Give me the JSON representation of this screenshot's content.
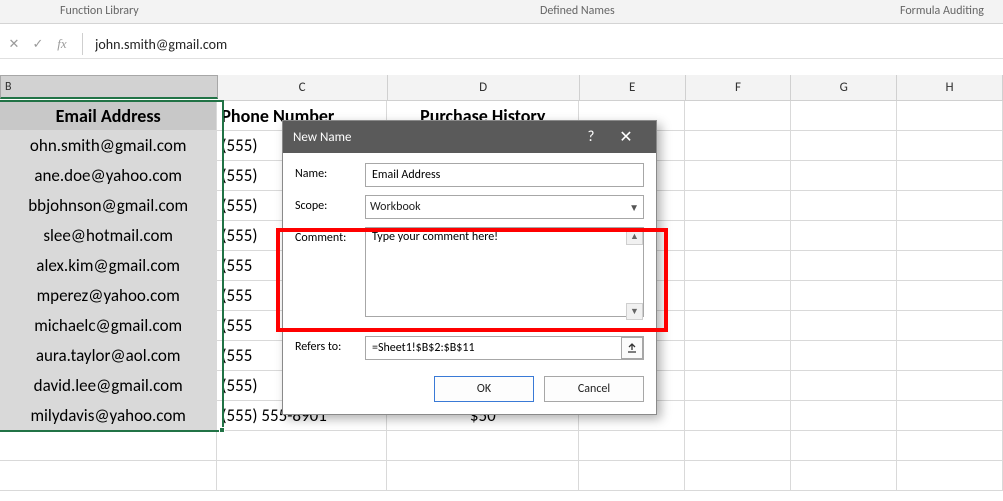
{
  "ribbon": {
    "group1": "Function Library",
    "group2": "Defined Names",
    "group3": "Formula Auditing"
  },
  "formula_bar": {
    "cancel_icon": "✕",
    "accept_icon": "✓",
    "fx_label": "fx",
    "value": "john.smith@gmail.com"
  },
  "columns": {
    "B": "B",
    "C": "C",
    "D": "D",
    "E": "E",
    "F": "F",
    "G": "G",
    "H": "H"
  },
  "sheet": {
    "header": {
      "B": "Email Address",
      "C": "Phone Number",
      "D": "Purchase History"
    },
    "rows": [
      {
        "B": "ohn.smith@gmail.com",
        "C": "(555)",
        "D": ""
      },
      {
        "B": "ane.doe@yahoo.com",
        "C": "(555)",
        "D": ""
      },
      {
        "B": "bbjohnson@gmail.com",
        "C": "(555)",
        "D": ""
      },
      {
        "B": "slee@hotmail.com",
        "C": "(555)",
        "D": ""
      },
      {
        "B": "alex.kim@gmail.com",
        "C": "(555",
        "D": ""
      },
      {
        "B": "mperez@yahoo.com",
        "C": "(555",
        "D": ""
      },
      {
        "B": "michaelc@gmail.com",
        "C": "(555",
        "D": ""
      },
      {
        "B": "aura.taylor@aol.com",
        "C": "(555",
        "D": ""
      },
      {
        "B": "david.lee@gmail.com",
        "C": "(555)",
        "D": ""
      },
      {
        "B": "milydavis@yahoo.com",
        "C": "(555) 555-8901",
        "D": "$50"
      }
    ]
  },
  "dialog": {
    "title": "New Name",
    "labels": {
      "name": "Name:",
      "scope": "Scope:",
      "comment": "Comment:",
      "refers": "Refers to:"
    },
    "name_value": "Email Address",
    "scope_value": "Workbook",
    "comment_value": "Type your comment here!",
    "refers_value": "=Sheet1!$B$2:$B$11",
    "ok": "OK",
    "cancel": "Cancel"
  }
}
